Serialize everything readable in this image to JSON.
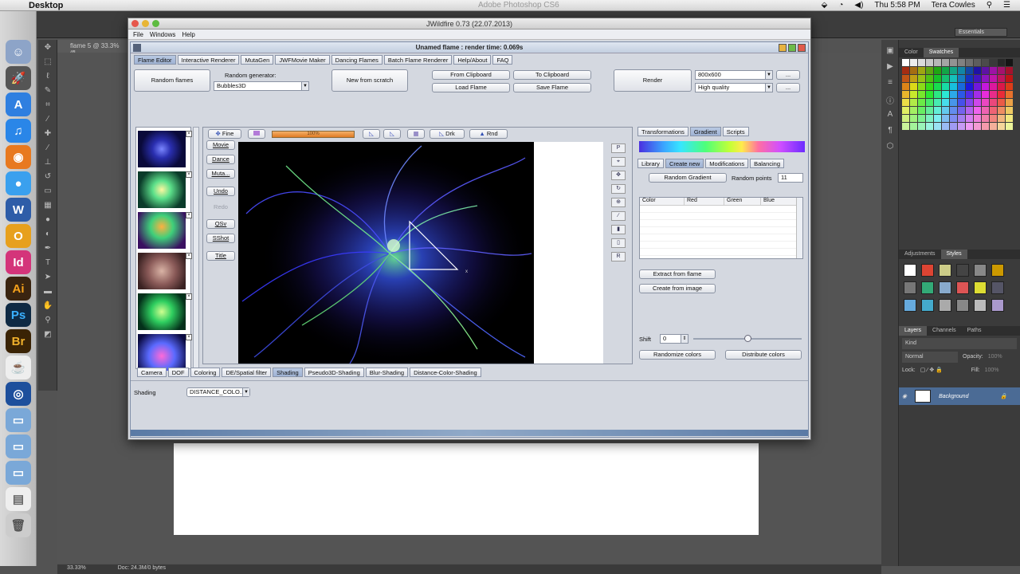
{
  "menubar": {
    "app": "Desktop",
    "ps_title": "Adobe Photoshop CS6",
    "clock": "Thu 5:58 PM",
    "user": "Tera Cowles"
  },
  "photoshop": {
    "workspace": "Essentials",
    "doc_tab": "flame 5 @ 33.3% (fl...",
    "zoom": "33.33%",
    "doc_size": "Doc: 24.3M/0 bytes",
    "panel_tabs_top": [
      "Color",
      "Swatches"
    ],
    "panel_tabs_mid": [
      "Adjustments",
      "Styles"
    ],
    "panel_tabs_layers": [
      "Layers",
      "Channels",
      "Paths"
    ],
    "layer_kind": "Kind",
    "blend_mode": "Normal",
    "opacity_label": "Opacity:",
    "opacity_value": "100%",
    "lock_label": "Lock:",
    "fill_label": "Fill:",
    "fill_value": "100%",
    "layer_name": "Background"
  },
  "jwildfire": {
    "window_title": "JWildfire 0.73 (22.07.2013)",
    "menu": [
      "File",
      "Windows",
      "Help"
    ],
    "render_title": "Unamed flame : render time: 0.069s",
    "top_tabs": [
      "Flame Editor",
      "Interactive Renderer",
      "MutaGen",
      "JWFMovie Maker",
      "Dancing Flames",
      "Batch Flame Renderer",
      "Help/About",
      "FAQ"
    ],
    "active_top_tab": 0,
    "buttons": {
      "random_flames": "Random flames",
      "random_generator_label": "Random generator:",
      "random_generator_value": "Bubbles3D",
      "new_from_scratch": "New from scratch",
      "from_clipboard": "From Clipboard",
      "to_clipboard": "To Clipboard",
      "load_flame": "Load Flame",
      "save_flame": "Save Flame",
      "render": "Render",
      "resolution": "800x600",
      "quality": "High quality",
      "dots": "..."
    },
    "left_buttons": [
      "Movie",
      "Dance",
      "Muta...",
      "Undo",
      "Redo",
      "QSv",
      "SShot",
      "Title"
    ],
    "preview_toolbar": {
      "fine": "Fine",
      "progress": "100%",
      "progress_fraction": 1.0,
      "drk": "Drk",
      "rnd": "Rnd"
    },
    "right_tools": [
      "P",
      "⌖",
      "✥",
      "↻",
      "⊕",
      "∕",
      "▮",
      "▯",
      "R"
    ],
    "editor_tabs": [
      "Transformations",
      "Gradient",
      "Scripts"
    ],
    "active_editor_tab": 1,
    "gradient_tabs": [
      "Library",
      "Create new",
      "Modifications",
      "Balancing"
    ],
    "active_gradient_tab": 1,
    "random_gradient": "Random Gradient",
    "random_points_label": "Random points",
    "random_points_value": "11",
    "table_headers": [
      "Color",
      "Red",
      "Green",
      "Blue"
    ],
    "extract_from_flame": "Extract from flame",
    "create_from_image": "Create from image",
    "shift_label": "Shift",
    "shift_value": "0",
    "randomize_colors": "Randomize colors",
    "distribute_colors": "Distribute colors",
    "bottom_tabs": [
      "Camera",
      "DOF",
      "Coloring",
      "DE/Spatial filter",
      "Shading",
      "Pseudo3D-Shading",
      "Blur-Shading",
      "Distance-Color-Shading"
    ],
    "active_bottom_tab": 4,
    "shading_label": "Shading",
    "shading_value": "DISTANCE_COLO..."
  }
}
